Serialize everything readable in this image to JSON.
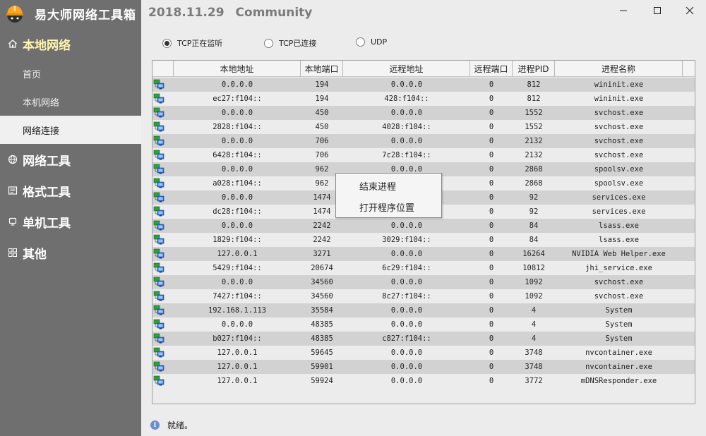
{
  "app": {
    "title": "易大师网络工具箱",
    "version": "2018.11.29",
    "edition": "Community"
  },
  "sidebar": {
    "groups": [
      {
        "label": "本地网络",
        "icon": "home-icon",
        "active": true,
        "items": [
          {
            "label": "首页"
          },
          {
            "label": "本机网络"
          },
          {
            "label": "网络连接",
            "active": true
          }
        ]
      },
      {
        "label": "网络工具",
        "icon": "globe-icon"
      },
      {
        "label": "格式工具",
        "icon": "document-icon"
      },
      {
        "label": "单机工具",
        "icon": "monitor-icon"
      },
      {
        "label": "其他",
        "icon": "grid-icon"
      }
    ]
  },
  "filters": {
    "options": [
      {
        "label": "TCP正在监听",
        "selected": true
      },
      {
        "label": "TCP已连接"
      },
      {
        "label": "UDP"
      }
    ]
  },
  "table": {
    "columns": [
      "本地地址",
      "本地端口",
      "远程地址",
      "远程端口",
      "进程PID",
      "进程名称"
    ],
    "rows": [
      [
        "0.0.0.0",
        "194",
        "0.0.0.0",
        "0",
        "812",
        "wininit.exe"
      ],
      [
        "ec27:f104::",
        "194",
        "428:f104::",
        "0",
        "812",
        "wininit.exe"
      ],
      [
        "0.0.0.0",
        "450",
        "0.0.0.0",
        "0",
        "1552",
        "svchost.exe"
      ],
      [
        "2828:f104::",
        "450",
        "4028:f104::",
        "0",
        "1552",
        "svchost.exe"
      ],
      [
        "0.0.0.0",
        "706",
        "0.0.0.0",
        "0",
        "2132",
        "svchost.exe"
      ],
      [
        "6428:f104::",
        "706",
        "7c28:f104::",
        "0",
        "2132",
        "svchost.exe"
      ],
      [
        "0.0.0.0",
        "962",
        "0.0.0.0",
        "0",
        "2868",
        "spoolsv.exe"
      ],
      [
        "a028:f104::",
        "962",
        "",
        "0",
        "2868",
        "spoolsv.exe"
      ],
      [
        "0.0.0.0",
        "1474",
        "",
        "0",
        "92",
        "services.exe"
      ],
      [
        "dc28:f104::",
        "1474",
        "",
        "0",
        "92",
        "services.exe"
      ],
      [
        "0.0.0.0",
        "2242",
        "0.0.0.0",
        "0",
        "84",
        "lsass.exe"
      ],
      [
        "1829:f104::",
        "2242",
        "3029:f104::",
        "0",
        "84",
        "lsass.exe"
      ],
      [
        "127.0.0.1",
        "3271",
        "0.0.0.0",
        "0",
        "16264",
        "NVIDIA Web Helper.exe"
      ],
      [
        "5429:f104::",
        "20674",
        "6c29:f104::",
        "0",
        "10812",
        "jhi_service.exe"
      ],
      [
        "0.0.0.0",
        "34560",
        "0.0.0.0",
        "0",
        "1092",
        "svchost.exe"
      ],
      [
        "7427:f104::",
        "34560",
        "8c27:f104::",
        "0",
        "1092",
        "svchost.exe"
      ],
      [
        "192.168.1.113",
        "35584",
        "0.0.0.0",
        "0",
        "4",
        "System"
      ],
      [
        "0.0.0.0",
        "48385",
        "0.0.0.0",
        "0",
        "4",
        "System"
      ],
      [
        "b027:f104::",
        "48385",
        "c827:f104::",
        "0",
        "4",
        "System"
      ],
      [
        "127.0.0.1",
        "59645",
        "0.0.0.0",
        "0",
        "3748",
        "nvcontainer.exe"
      ],
      [
        "127.0.0.1",
        "59901",
        "0.0.0.0",
        "0",
        "3748",
        "nvcontainer.exe"
      ],
      [
        "127.0.0.1",
        "59924",
        "0.0.0.0",
        "0",
        "3772",
        "mDNSResponder.exe"
      ]
    ]
  },
  "context_menu": {
    "items": [
      {
        "label": "结束进程"
      },
      {
        "label": "打开程序位置"
      }
    ]
  },
  "status": {
    "text": "就绪。"
  },
  "colors": {
    "sidebar_bg": "#6f6f6f",
    "active_group_text": "#fff7b0",
    "row_alt": "#d2d2d2",
    "row": "#ececec"
  }
}
